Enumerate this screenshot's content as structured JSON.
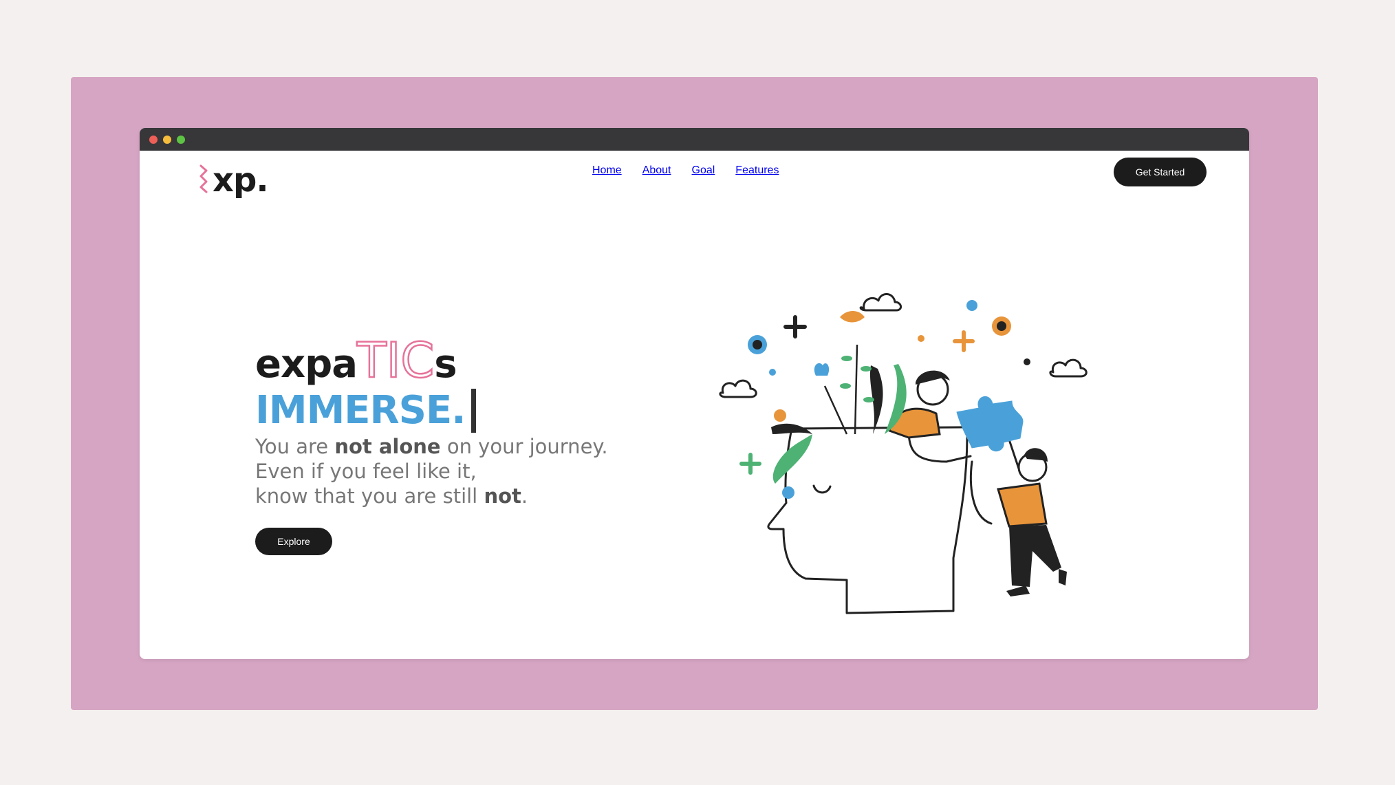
{
  "logo": {
    "text": "xp."
  },
  "nav": {
    "items": [
      {
        "label": "Home"
      },
      {
        "label": "About"
      },
      {
        "label": "Goal"
      },
      {
        "label": "Features"
      }
    ],
    "cta_label": "Get Started"
  },
  "hero": {
    "title_prefix": "expa",
    "title_outline": "TIC",
    "title_suffix": "s",
    "subtitle": "IMMERSE.",
    "line1_a": "You are ",
    "line1_b": "not alone",
    "line1_c": " on your journey.",
    "line2": "Even if you feel like it,",
    "line3_a": "know that you are still ",
    "line3_b": "not",
    "line3_c": ".",
    "button_label": "Explore"
  },
  "colors": {
    "frame": "#d6a5c3",
    "background": "#f4f0ef",
    "accent_pink": "#e6729a",
    "accent_blue": "#4aa1d9",
    "accent_orange": "#e8943a",
    "accent_green": "#4db274",
    "dark": "#1c1c1c"
  }
}
